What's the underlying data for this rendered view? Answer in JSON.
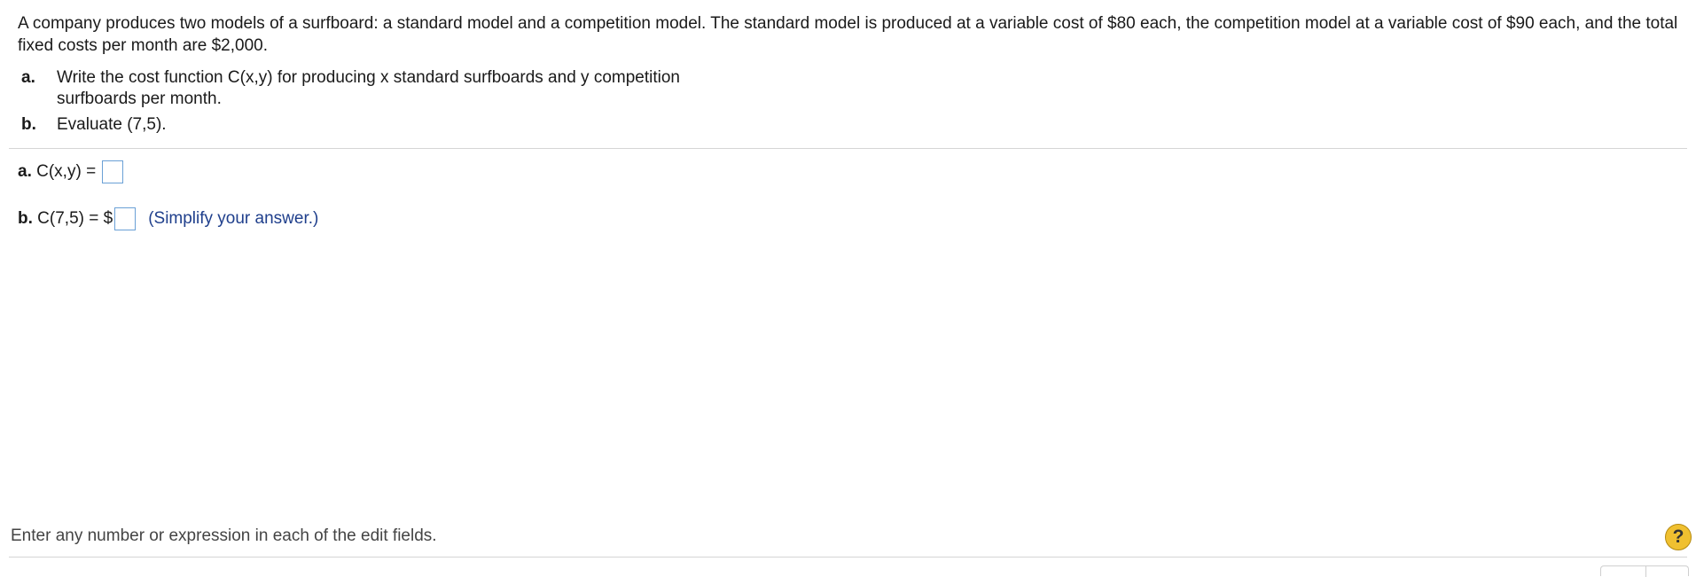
{
  "problem": {
    "text": "A company produces two models of a surfboard: a standard model and a competition model. The standard model is produced at a variable cost of $80 each, the competition model at a variable cost of $90 each, and the total fixed costs per month are $2,000."
  },
  "parts": [
    {
      "letter": "a.",
      "text": "Write the cost function C(x,y) for producing x standard surfboards and y competition surfboards per month."
    },
    {
      "letter": "b.",
      "text": "Evaluate (7,5)."
    }
  ],
  "answers": {
    "a": {
      "letter": "a.",
      "label": " C(x,y) = ",
      "value": ""
    },
    "b": {
      "letter": "b.",
      "label": " C(7,5) = $",
      "value": "",
      "hint": "(Simplify your answer.)"
    }
  },
  "footer": {
    "instruction": "Enter any number or expression in each of the edit fields.",
    "help_label": "?"
  },
  "icons": {
    "help": "help-icon"
  },
  "colors": {
    "hint": "#1f3f8c",
    "input_border": "#6aa0d6",
    "help_button": "#f0c030"
  }
}
